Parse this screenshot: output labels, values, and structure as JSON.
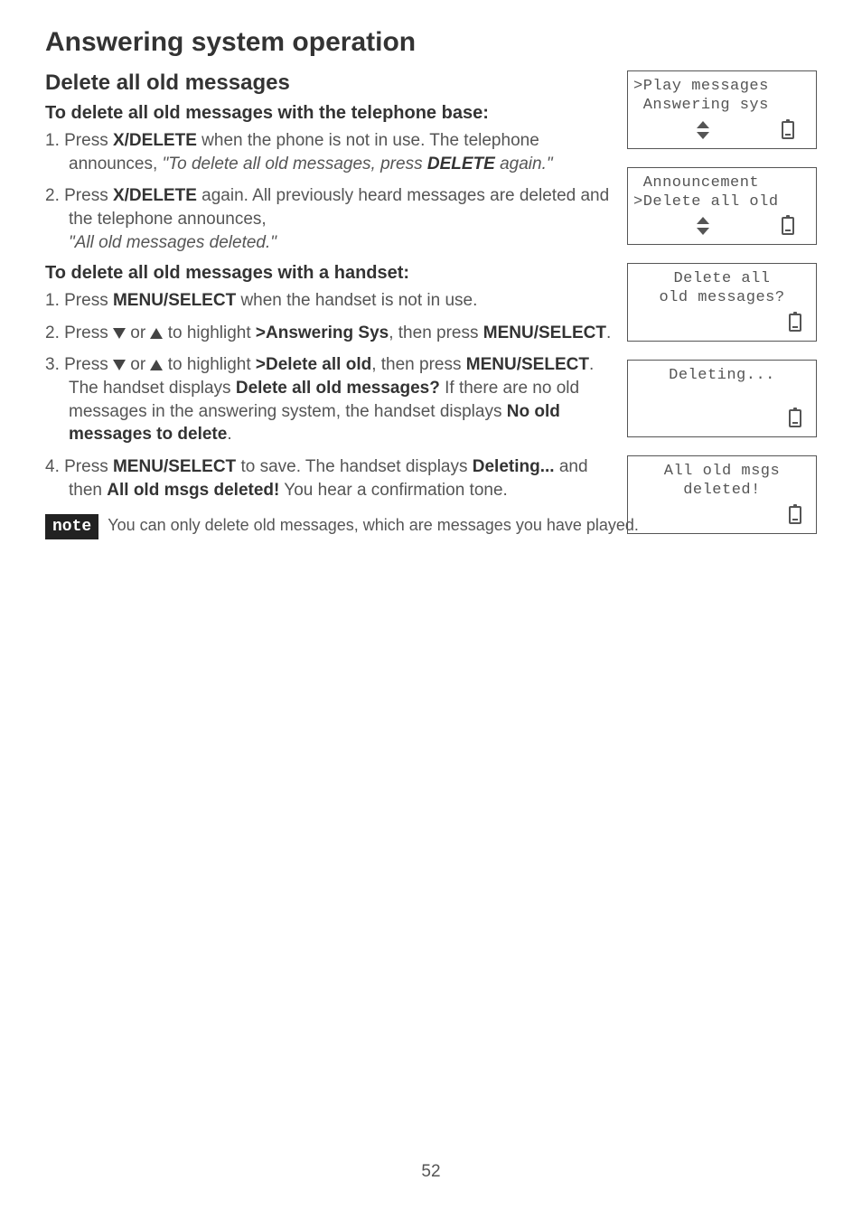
{
  "page_title": "Answering system operation",
  "section_title": "Delete all old messages",
  "sub1_title": "To delete all old messages with the telephone base:",
  "steps1": {
    "s1_pre": "1.  Press ",
    "s1_b1": "X/DELETE",
    "s1_mid": " when the phone is not in use. The telephone announces, ",
    "s1_i": "\"To delete all old messages, press ",
    "s1_bi": "DELETE",
    "s1_i2": " again.\"",
    "s2_pre": "2.  Press ",
    "s2_b1": "X/DELETE",
    "s2_mid": " again. All previously heard messages are deleted and the telephone announces,",
    "s2_i": "\"All old messages deleted.\""
  },
  "sub2_title": "To delete all old messages with a handset:",
  "steps2": {
    "s1_pre": "1.  Press ",
    "s1_b1": "MENU/",
    "s1_sc": "SELECT",
    "s1_post": " when the handset is not in use.",
    "s2_pre": "2.  Press ",
    "s2_mid": " or ",
    "s2_mid2": " to highlight ",
    "s2_b1": ">Answering Sys",
    "s2_post": ", then press ",
    "s2_sc": "MENU",
    "s2_b2": "/SELECT",
    "s2_end": ".",
    "s3_pre": "3.  Press ",
    "s3_mid": " or ",
    "s3_mid2": " to highlight ",
    "s3_b1": ">Delete all old",
    "s3_post": ", then press ",
    "s3_sc": "MENU",
    "s3_b2": "/SELECT",
    "s3_post2": ". The handset displays ",
    "s3_b3": "Delete all old messages?",
    "s3_post3": " If there are no old messages in the answering system, the handset displays ",
    "s3_b4": "No old messages to delete",
    "s3_end": ".",
    "s4_pre": "4.  Press ",
    "s4_sc": "MENU",
    "s4_b1": "/SELECT",
    "s4_mid": " to save. The handset displays ",
    "s4_b2": "Deleting...",
    "s4_mid2": " and then ",
    "s4_b3": "All old msgs deleted!",
    "s4_post": " You hear a confirmation tone."
  },
  "note_label": "note",
  "note_text": "You can only delete old messages, which are messages you have played.",
  "screens": {
    "scr1_l1": ">Play messages",
    "scr1_l2": " Answering sys",
    "scr2_l1": " Announcement",
    "scr2_l2": ">Delete all old",
    "scr3_l1": "Delete all",
    "scr3_l2": "old messages?",
    "scr4_l1": "Deleting...",
    "scr5_l1": "All old msgs",
    "scr5_l2": "deleted!"
  },
  "page_number": "52"
}
